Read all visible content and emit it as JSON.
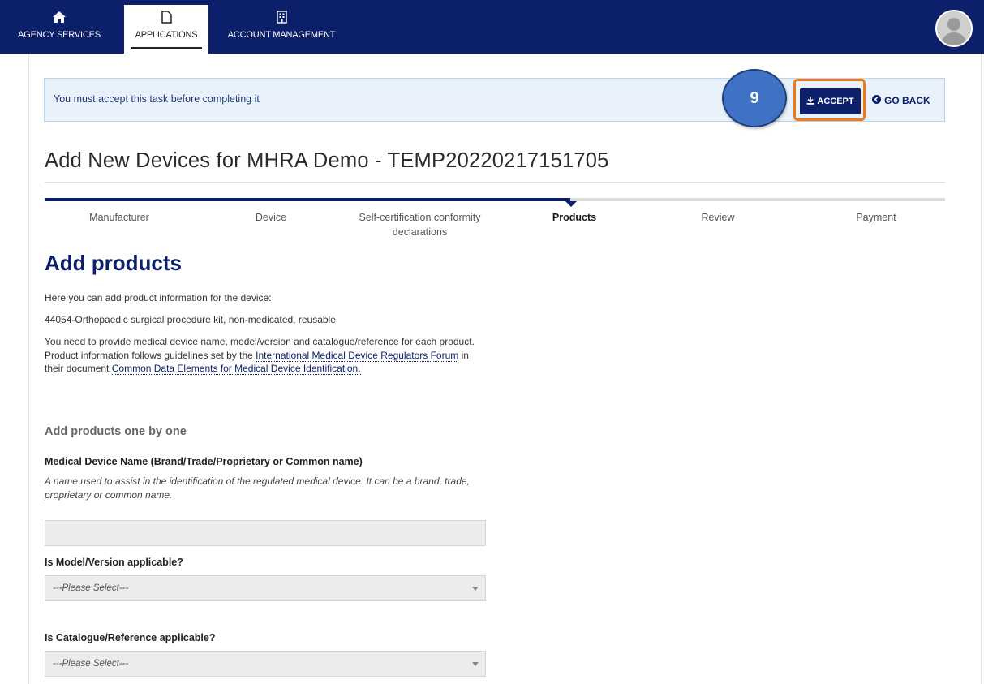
{
  "nav": {
    "items": [
      {
        "label": "AGENCY SERVICES",
        "icon": "home-icon"
      },
      {
        "label": "APPLICATIONS",
        "icon": "document-icon",
        "active": true
      },
      {
        "label": "ACCOUNT MANAGEMENT",
        "icon": "building-icon"
      }
    ],
    "avatar_icon": "user-avatar-icon"
  },
  "alert": {
    "message": "You must accept this task before completing it",
    "step_number": "9",
    "accept_label": "ACCEPT",
    "goback_label": "GO BACK"
  },
  "page": {
    "title": "Add New Devices for MHRA Demo - TEMP20220217151705"
  },
  "stepper": {
    "steps": [
      {
        "label": "Manufacturer"
      },
      {
        "label": "Device"
      },
      {
        "label": "Self-certification conformity declarations"
      },
      {
        "label": "Products",
        "current": true
      },
      {
        "label": "Review"
      },
      {
        "label": "Payment"
      }
    ],
    "progress_step": 4
  },
  "form": {
    "heading": "Add products",
    "intro": "Here you can add product information for the device:",
    "device_name": "44054-Orthopaedic surgical procedure kit, non-medicated, reusable",
    "guide_text_1": "You need to provide medical device name, model/version and catalogue/reference for each product. Product information follows guidelines set by the",
    "guide_link_1": "International Medical Device Regulators Forum",
    "guide_text_2": "in their document",
    "guide_link_2": "Common Data Elements for Medical Device Identification.",
    "section_heading": "Add products one by one",
    "name_label": "Medical Device Name (Brand/Trade/Proprietary or Common name)",
    "name_hint": "A name used to assist in the identification of the regulated medical device. It can be a brand, trade, proprietary or common name.",
    "name_value": "",
    "model_label": "Is Model/Version applicable?",
    "model_select": "---Please Select---",
    "catalogue_label": "Is Catalogue/Reference applicable?",
    "catalogue_select": "---Please Select---"
  },
  "colors": {
    "brand_navy": "#0b1f6b",
    "highlight_orange": "#f07a1a",
    "alert_bg": "#e9f2fb",
    "step_marker": "#3f72c4"
  }
}
